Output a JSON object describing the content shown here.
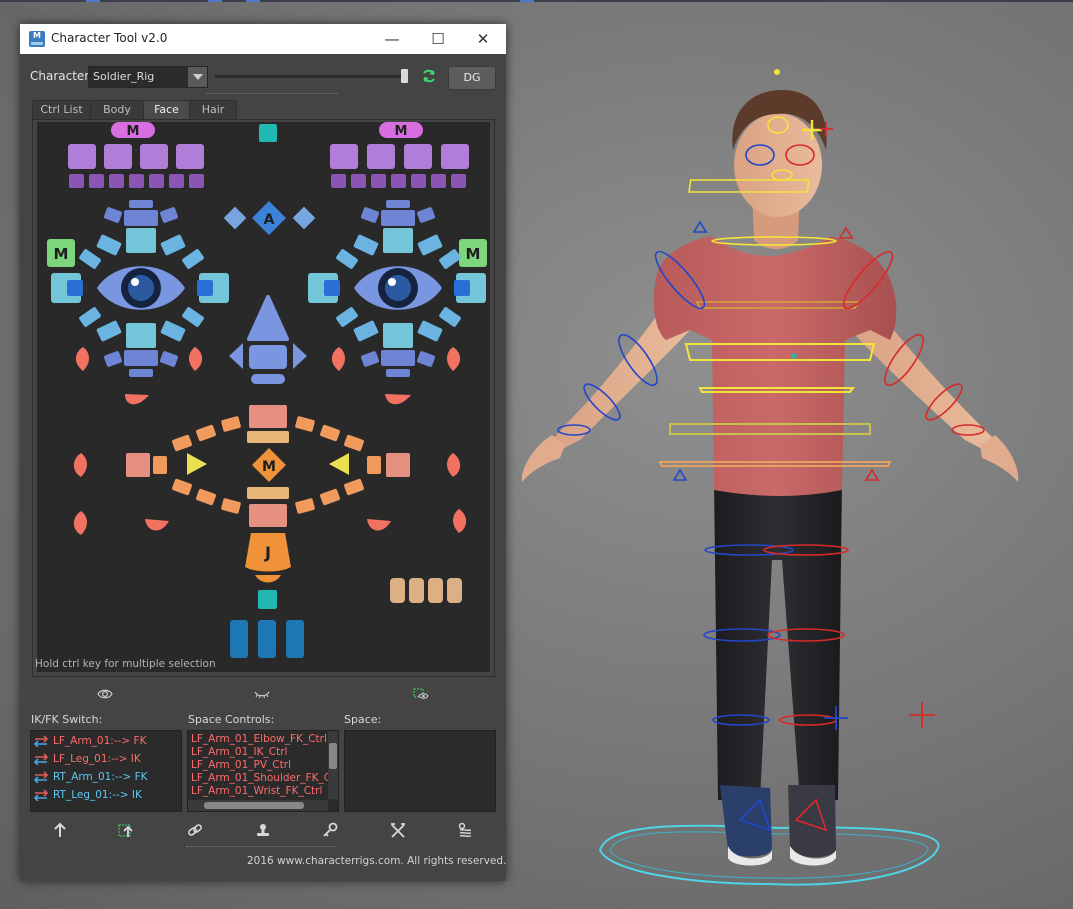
{
  "window": {
    "title": "Character Tool v2.0",
    "app_icon_text": "M",
    "minimize_glyph": "—",
    "maximize_glyph": "☐",
    "close_glyph": "✕"
  },
  "character": {
    "label": "Character:",
    "selected": "Soldier_Rig",
    "dg_button": "DG"
  },
  "tabs": [
    {
      "label": "Ctrl List",
      "active": false
    },
    {
      "label": "Body",
      "active": false
    },
    {
      "label": "Face",
      "active": true
    },
    {
      "label": "Hair",
      "active": false
    }
  ],
  "face_panel": {
    "hint": "Hold ctrl key for multiple selection",
    "labels": {
      "mirror": "M",
      "center": "A",
      "mouth_center": "M",
      "jaw": "J"
    },
    "colors": {
      "brow": "#b07ed8",
      "mirror_badge": "#d86ee0",
      "center": "#20b8b0",
      "eye_outer": "#74c5da",
      "eye_lid": "#6e84d4",
      "iris": "#2c5aa0",
      "green_m": "#7dd67d",
      "cheek": "#f27262",
      "nose": "#7a96e0",
      "lip_outer": "#f09a5e",
      "lip_inner": "#e8b678",
      "lip_mid": "#e59080",
      "jaw": "#f09238",
      "tongue": "#1d77b5",
      "teeth": "#dcb084",
      "arrow": "#e9e14f"
    }
  },
  "visibility_icons": [
    "eye-icon",
    "eye-closed-icon",
    "select-visible-icon"
  ],
  "ikfk": {
    "label": "IK/FK Switch:",
    "items": [
      {
        "text": "LF_Arm_01:--> FK",
        "color": "#ff6b6b"
      },
      {
        "text": "LF_Leg_01:--> IK",
        "color": "#ff6b6b"
      },
      {
        "text": "RT_Arm_01:--> FK",
        "color": "#5ec8f0"
      },
      {
        "text": "RT_Leg_01:--> IK",
        "color": "#5ec8f0"
      }
    ]
  },
  "space_controls": {
    "label": "Space Controls:",
    "items": [
      "LF_Arm_01_Elbow_FK_Ctrl",
      "LF_Arm_01_IK_Ctrl",
      "LF_Arm_01_PV_Ctrl",
      "LF_Arm_01_Shoulder_FK_C",
      "LF_Arm_01_Wrist_FK_Ctrl"
    ]
  },
  "space": {
    "label": "Space:"
  },
  "toolbar_icons": [
    "up-arrow-icon",
    "select-up-icon",
    "link-icon",
    "stamp-icon",
    "key-icon",
    "cross-tools-icon",
    "stack-icon"
  ],
  "footer": {
    "copyright": "2016 www.characterrigs.com. All rights reserved."
  }
}
